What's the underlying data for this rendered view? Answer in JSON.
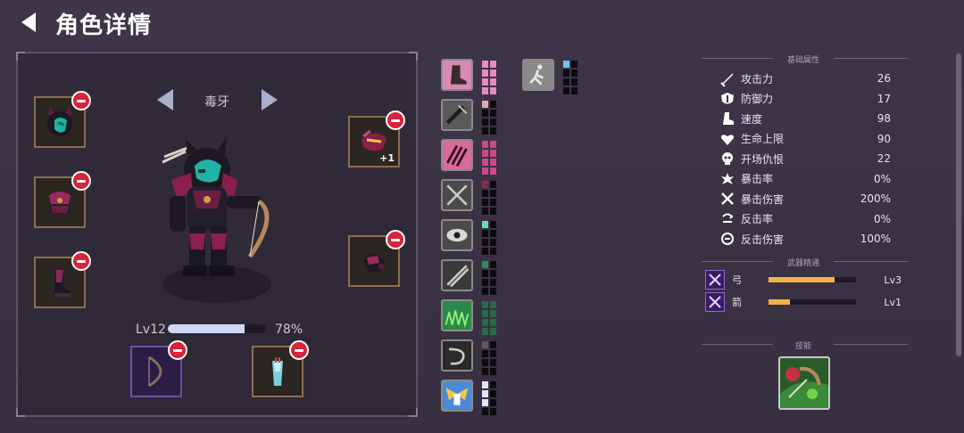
{
  "header": {
    "title": "角色详情",
    "back_icon": "back-arrow-icon"
  },
  "character": {
    "name": "毒牙",
    "level_label": "Lv12",
    "xp_percent": "78%",
    "xp_fraction": 0.78,
    "equipment": {
      "head": {
        "icon": "horned-helmet-icon"
      },
      "chest": {
        "icon": "armor-icon"
      },
      "boots": {
        "icon": "boots-icon"
      },
      "offhand": {
        "icon": "mask-icon",
        "plus": "+1"
      },
      "gloves": {
        "icon": "gauntlet-icon"
      },
      "weapon": {
        "icon": "bow-icon"
      },
      "ammo": {
        "icon": "quiver-icon"
      }
    }
  },
  "inventory": [
    {
      "icon": "boot-gear-icon",
      "pips_lit": 4,
      "pip_color": "#e88ac0"
    },
    {
      "icon": "spiked-club-icon",
      "pips_lit": 1,
      "pip_color": "#e8a8a8"
    },
    {
      "icon": "claw-slash-icon",
      "pips_lit": 4,
      "pip_color": "#c84a88"
    },
    {
      "icon": "crossed-swords-icon",
      "pips_lit": 1,
      "pip_color": "#8a2a4a"
    },
    {
      "icon": "eye-icon",
      "pips_lit": 1,
      "pip_color": "#6ad8b0"
    },
    {
      "icon": "double-blade-icon",
      "pips_lit": 1,
      "pip_color": "#2a8a5a"
    },
    {
      "icon": "grass-field-icon",
      "pips_lit": 4,
      "pip_color": "#2a6a4a"
    },
    {
      "icon": "whirlwind-icon",
      "pips_lit": 1,
      "pip_color": "#5a5a5a"
    },
    {
      "icon": "wings-icon",
      "pips_lit": 3,
      "pip_color": "#dfe8f8"
    },
    {
      "icon": "runner-icon",
      "pips_lit": 1,
      "pip_color": "#6ac8f0"
    }
  ],
  "stats": {
    "basic_title": "基础属性",
    "rows": [
      {
        "icon": "sword-icon",
        "label": "攻击力",
        "value": "26"
      },
      {
        "icon": "shield-icon",
        "label": "防御力",
        "value": "17"
      },
      {
        "icon": "boot-icon",
        "label": "速度",
        "value": "98"
      },
      {
        "icon": "heart-icon",
        "label": "生命上限",
        "value": "90"
      },
      {
        "icon": "skull-icon",
        "label": "开场仇恨",
        "value": "22"
      },
      {
        "icon": "crit-burst-icon",
        "label": "暴击率",
        "value": "0%"
      },
      {
        "icon": "crit-swords-icon",
        "label": "暴击伤害",
        "value": "200%"
      },
      {
        "icon": "counter-icon",
        "label": "反击率",
        "value": "0%"
      },
      {
        "icon": "counter-damage-icon",
        "label": "反击伤害",
        "value": "100%"
      }
    ],
    "mastery_title": "武器精通",
    "mastery": [
      {
        "icon": "bow-mastery-icon",
        "label": "弓",
        "level": "Lv3",
        "fraction": 0.76
      },
      {
        "icon": "arrow-mastery-icon",
        "label": "箭",
        "level": "Lv1",
        "fraction": 0.24
      }
    ],
    "skill_title": "技能",
    "skill_icon": "poison-archer-skill-icon"
  },
  "colors": {
    "accent_orange": "#f0b24a",
    "remove_red": "#d6243a",
    "panel_border": "#5c5366"
  }
}
